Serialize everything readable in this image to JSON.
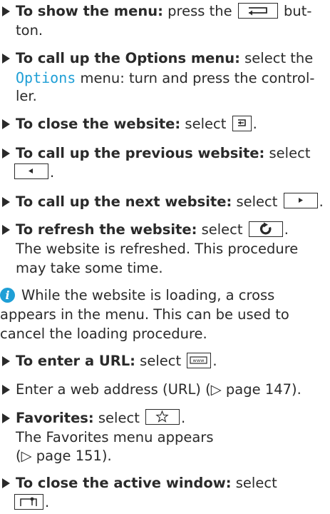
{
  "items": [
    {
      "id": "show-menu",
      "bold": "To show the menu:",
      "pre": " press the",
      "post": " but-",
      "line2": "ton."
    },
    {
      "id": "options-menu",
      "bold": "To call up the Options menu:",
      "pre": " select the",
      "menu_term": "Options",
      "post": " menu: turn and press the control-",
      "line3": "ler."
    },
    {
      "id": "close-website",
      "bold": "To close the website:",
      "pre": " select",
      "post": "."
    },
    {
      "id": "previous-website",
      "bold": "To call up the previous website:",
      "pre": " select",
      "post": "."
    },
    {
      "id": "next-website",
      "bold": "To call up the next website:",
      "pre": " select",
      "post": "."
    },
    {
      "id": "refresh-website",
      "bold": "To refresh the website:",
      "pre": " select",
      "post": ".",
      "line2": "The website is refreshed. This procedure",
      "line3": "may take some time."
    },
    {
      "id": "enter-url",
      "bold": "To enter a URL:",
      "pre": " select",
      "post": "."
    },
    {
      "id": "enter-address",
      "text": "Enter a web address (URL) (▷ page 147)."
    },
    {
      "id": "favorites",
      "bold": "Favorites:",
      "pre": " select",
      "post": ".",
      "line2": "The Favorites menu appears",
      "line3": "(▷ page 151)."
    },
    {
      "id": "close-active-window",
      "bold": "To close the active window:",
      "pre": " select",
      "post": "."
    }
  ],
  "note": {
    "icon": "info-icon",
    "letter": "i",
    "line1": "While the website is loading, a cross",
    "line2": "appears in the menu. This can be used to",
    "line3": "cancel the loading procedure."
  },
  "icons": {
    "back": "back-arrow-icon",
    "close": "close-website-icon",
    "previous": "previous-arrow-icon",
    "next": "next-arrow-icon",
    "refresh": "refresh-icon",
    "url": "www-icon",
    "favorites": "star-icon",
    "window": "window-close-icon"
  },
  "colors": {
    "accent": "#1f9fd6",
    "text": "#2a2a2a"
  }
}
